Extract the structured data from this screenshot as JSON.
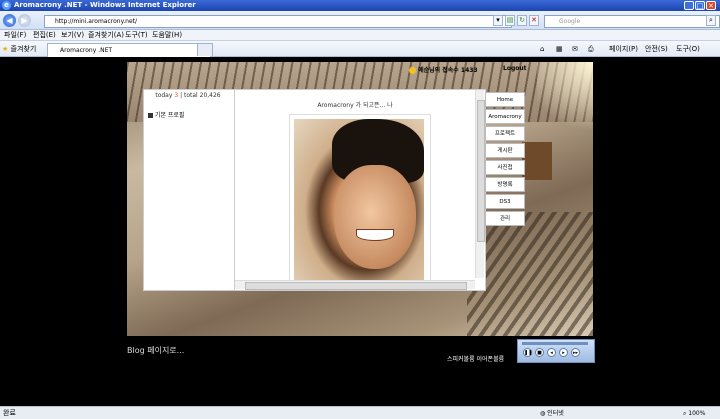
{
  "window": {
    "title": "Aromacrony .NET - Windows Internet Explorer",
    "minimize": "_",
    "maximize": "□",
    "close": "✕"
  },
  "address": {
    "url": "http://mini.aromacrony.net/",
    "search_placeholder": "Google"
  },
  "menu": [
    "파일(F)",
    "편집(E)",
    "보기(V)",
    "즐겨찾기(A)",
    "도구(T)",
    "도움말(H)"
  ],
  "tabbar": {
    "favorites": "즐겨찾기",
    "tab_title": "Aromacrony .NET",
    "commands": [
      "페이지(P)",
      "안전(S)",
      "도구(O)"
    ]
  },
  "minihome": {
    "counter_today_label": "today",
    "counter_today": "3",
    "counter_total": "| total 20,426",
    "profile_link": "기본 프로필",
    "main_title": "Aromacrony 가 되고픈... 나",
    "visitor_text": "애순님의 접속수 1433",
    "logout": "Logout",
    "menu_tabs": [
      "Home",
      "Aromacrony",
      "프로젝트",
      "게시판",
      "사진첩",
      "방명록",
      "DS3",
      "관리"
    ],
    "blog_link": "Blog 페이지로...",
    "speaker_text": "스피커볼륨 이어폰볼륨"
  },
  "player": {
    "buttons": [
      "❚❚",
      "■",
      "◂",
      "▸",
      "▸▸"
    ]
  },
  "status": {
    "left": "완료",
    "zone": "인터넷",
    "zoom": "100%"
  },
  "colors": {
    "titlebar": "#1c44b0",
    "counter_today": "#e64d00"
  }
}
